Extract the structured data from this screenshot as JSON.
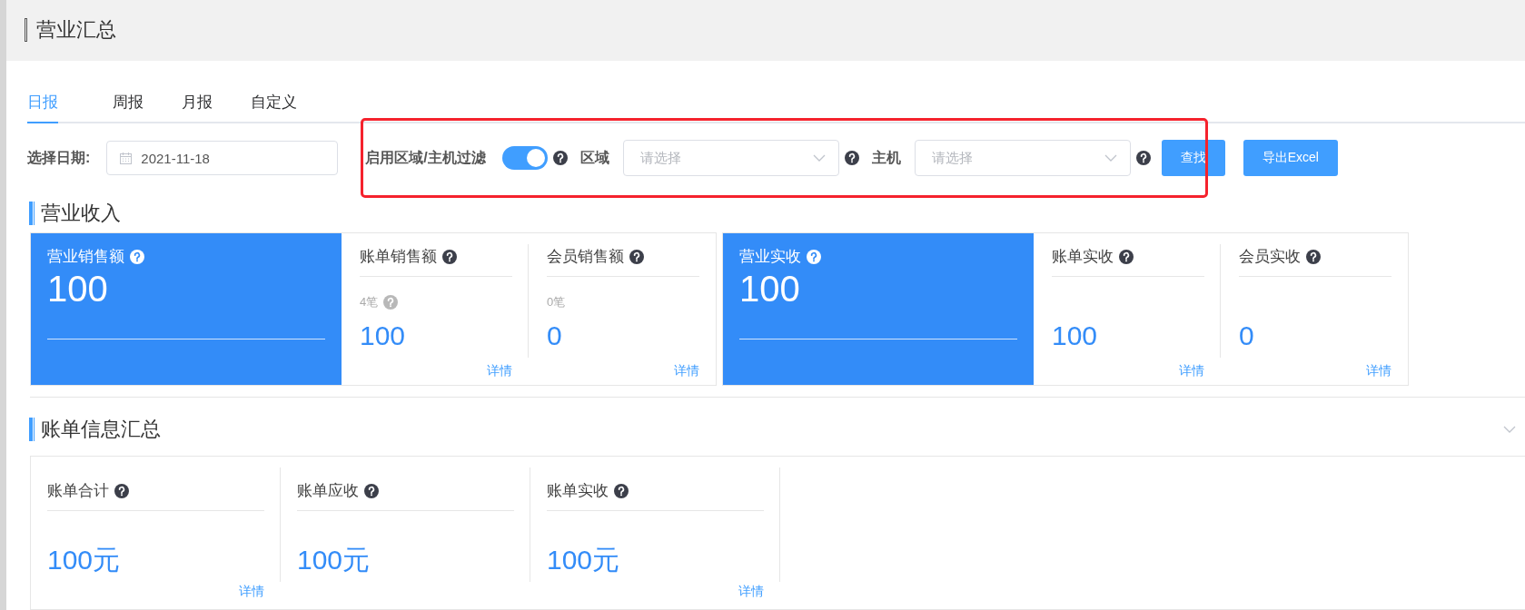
{
  "header": {
    "title": "营业汇总"
  },
  "tabs": [
    {
      "label": "日报",
      "selected": true
    },
    {
      "label": "周报",
      "selected": false
    },
    {
      "label": "月报",
      "selected": false
    },
    {
      "label": "自定义",
      "selected": false
    }
  ],
  "filter": {
    "date_label": "选择日期:",
    "date_value": "2021-11-18",
    "toggle_label": "启用区域/主机过滤",
    "toggle_on": true,
    "region_label": "区域",
    "region_placeholder": "请选择",
    "host_label": "主机",
    "host_placeholder": "请选择",
    "buttons": [
      "查找",
      "导出Excel"
    ]
  },
  "revenue": {
    "title": "营业收入",
    "groups": [
      {
        "primary": {
          "label": "营业销售额",
          "value": "100"
        },
        "subs": [
          {
            "label": "账单销售额",
            "count": "4笔",
            "count_help": true,
            "value": "100",
            "link": "详情"
          },
          {
            "label": "会员销售额",
            "count": "0笔",
            "count_help": false,
            "value": "0",
            "link": "详情"
          }
        ]
      },
      {
        "primary": {
          "label": "营业实收",
          "value": "100"
        },
        "subs": [
          {
            "label": "账单实收",
            "value": "100",
            "link": "详情"
          },
          {
            "label": "会员实收",
            "value": "0",
            "link": "详情"
          }
        ]
      }
    ]
  },
  "bill_summary": {
    "title": "账单信息汇总",
    "items": [
      {
        "label": "账单合计",
        "value": "100元",
        "link": "详情"
      },
      {
        "label": "账单应收",
        "value": "100元"
      },
      {
        "label": "账单实收",
        "value": "100元",
        "link": "详情"
      }
    ]
  }
}
